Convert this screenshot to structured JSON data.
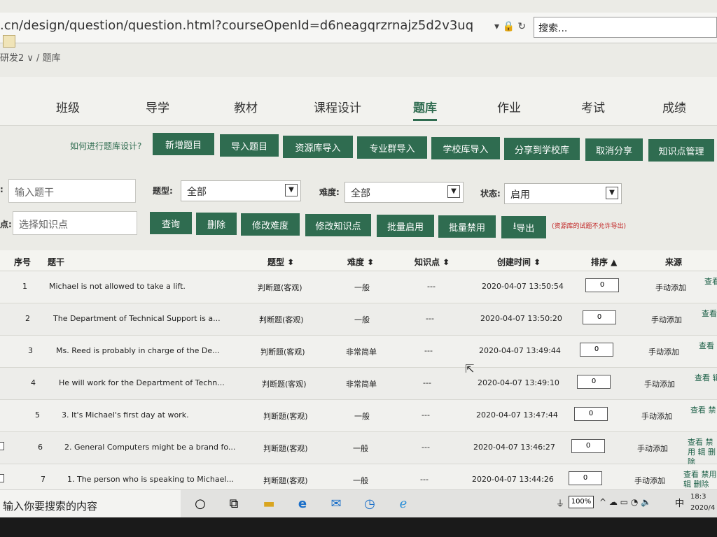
{
  "browser": {
    "url": ".cn/design/question/question.html?courseOpenId=d6neagqrzrnajz5d2v3uq",
    "search_placeholder": "搜索...",
    "breadcrumb": "研发2 ∨ / 题库"
  },
  "nav": {
    "items": [
      "班级",
      "导学",
      "教材",
      "课程设计",
      "题库",
      "作业",
      "考试",
      "成绩"
    ],
    "active": "题库"
  },
  "toolbar": {
    "help_link": "如何进行题库设计?",
    "buttons": [
      "新增题目",
      "导入题目",
      "资源库导入",
      "专业群导入",
      "学校库导入",
      "分享到学校库",
      "取消分享",
      "知识点管理"
    ]
  },
  "filters": {
    "stem_placeholder": "输入题干",
    "knowledge_placeholder": "选择知识点",
    "type_label": "题型:",
    "type_value": "全部",
    "difficulty_label": "难度:",
    "difficulty_value": "全部",
    "status_label": "状态:",
    "status_value": "启用",
    "stem_label_fragment": ":",
    "knowledge_label_fragment": "点:"
  },
  "actions": {
    "buttons": [
      "查询",
      "删除",
      "修改难度",
      "修改知识点",
      "批量启用",
      "批量禁用"
    ],
    "export_label": "导出",
    "note": "(资源库的试题不允许导出)"
  },
  "table": {
    "headers": {
      "index": "序号",
      "stem": "题干",
      "type": "题型 ⬍",
      "difficulty": "难度 ⬍",
      "knowledge": "知识点 ⬍",
      "created": "创建时间 ⬍",
      "sort": "排序 ▲",
      "source": "来源"
    },
    "rows": [
      {
        "index": "1",
        "stem": "Michael is not allowed to take a lift.",
        "type": "判断题(客观)",
        "difficulty": "一般",
        "knowledge": "---",
        "created": "2020-04-07 13:50:54",
        "sort": "0",
        "source": "手动添加",
        "ops": "查看"
      },
      {
        "index": "2",
        "stem": "The Department of Technical Support is a...",
        "type": "判断题(客观)",
        "difficulty": "一般",
        "knowledge": "---",
        "created": "2020-04-07 13:50:20",
        "sort": "0",
        "source": "手动添加",
        "ops": "查看"
      },
      {
        "index": "3",
        "stem": "Ms. Reed is probably in charge of the De...",
        "type": "判断题(客观)",
        "difficulty": "非常简单",
        "knowledge": "---",
        "created": "2020-04-07 13:49:44",
        "sort": "0",
        "source": "手动添加",
        "ops": "查看"
      },
      {
        "index": "4",
        "stem": "He will work for the Department of Techn...",
        "type": "判断题(客观)",
        "difficulty": "非常简单",
        "knowledge": "---",
        "created": "2020-04-07 13:49:10",
        "sort": "0",
        "source": "手动添加",
        "ops": "查看 辑"
      },
      {
        "index": "5",
        "stem": "3. It's Michael's first day at work.",
        "type": "判断题(客观)",
        "difficulty": "一般",
        "knowledge": "---",
        "created": "2020-04-07 13:47:44",
        "sort": "0",
        "source": "手动添加",
        "ops": "查看 禁"
      },
      {
        "index": "6",
        "stem": "2. General Computers might be a brand fo...",
        "type": "判断题(客观)",
        "difficulty": "一般",
        "knowledge": "---",
        "created": "2020-04-07 13:46:27",
        "sort": "0",
        "source": "手动添加",
        "ops": "查看 禁用 辑 删除"
      },
      {
        "index": "7",
        "stem": "1. The person who is speaking to Michael...",
        "type": "判断题(客观)",
        "difficulty": "一般",
        "knowledge": "---",
        "created": "2020-04-07 13:44:26",
        "sort": "0",
        "source": "手动添加",
        "ops": "查看 禁用 辑 删除"
      }
    ]
  },
  "taskbar": {
    "search_text": "输入你要搜索的内容",
    "battery": "100%",
    "ime": "中",
    "time": "18:3",
    "date": "2020/4"
  },
  "colors": {
    "primary_green": "#2f6c50",
    "warning_red": "#c02020"
  }
}
